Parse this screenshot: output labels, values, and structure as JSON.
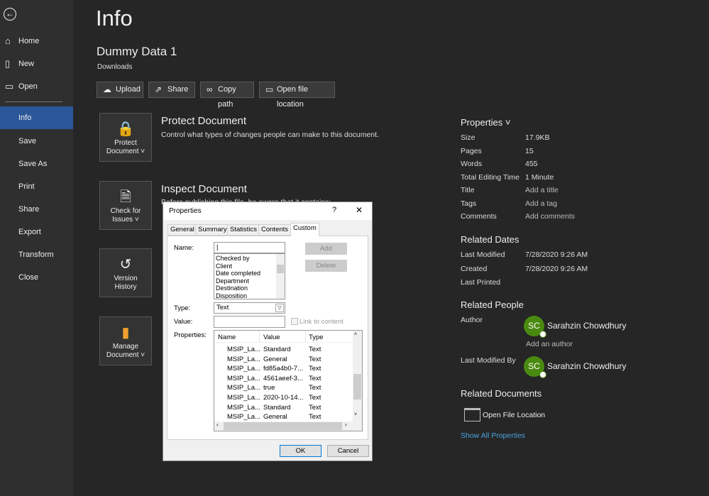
{
  "sidebar": {
    "back_icon": "back-arrow-icon",
    "items": [
      {
        "label": "Home",
        "icon": "home-icon"
      },
      {
        "label": "New",
        "icon": "new-document-icon"
      },
      {
        "label": "Open",
        "icon": "open-folder-icon"
      },
      {
        "label": "Info",
        "active": true
      },
      {
        "label": "Save"
      },
      {
        "label": "Save As"
      },
      {
        "label": "Print"
      },
      {
        "label": "Share"
      },
      {
        "label": "Export"
      },
      {
        "label": "Transform"
      },
      {
        "label": "Close"
      }
    ]
  },
  "page": {
    "title": "Info",
    "doc_name": "Dummy Data 1",
    "location": "Downloads"
  },
  "actions": [
    {
      "label": "Upload",
      "icon": "cloud-upload-icon"
    },
    {
      "label": "Share",
      "icon": "share-icon"
    },
    {
      "label": "Copy path",
      "icon": "link-icon"
    },
    {
      "label": "Open file location",
      "icon": "folder-icon"
    }
  ],
  "sections": [
    {
      "tile": [
        "Protect",
        "Document ˅"
      ],
      "title": "Protect Document",
      "desc": "Control what types of changes people can make to this document."
    },
    {
      "tile": [
        "Check for",
        "Issues ˅"
      ],
      "title": "Inspect Document",
      "desc": "Before publishing this file, be aware that it contains:"
    },
    {
      "tile": [
        "Version",
        "History"
      ]
    },
    {
      "tile": [
        "Manage",
        "Document ˅"
      ]
    }
  ],
  "properties": {
    "header": "Properties ˅",
    "rows": [
      {
        "label": "Size",
        "value": "17.9KB"
      },
      {
        "label": "Pages",
        "value": "15"
      },
      {
        "label": "Words",
        "value": "455"
      },
      {
        "label": "Total Editing Time",
        "value": "1 Minute"
      },
      {
        "label": "Title",
        "value": "Add a title"
      },
      {
        "label": "Tags",
        "value": "Add a tag"
      },
      {
        "label": "Comments",
        "value": "Add comments"
      }
    ]
  },
  "related_dates": {
    "header": "Related Dates",
    "rows": [
      {
        "label": "Last Modified",
        "value": "7/28/2020 9:26 AM"
      },
      {
        "label": "Created",
        "value": "7/28/2020 9:26 AM"
      },
      {
        "label": "Last Printed",
        "value": ""
      }
    ]
  },
  "related_people": {
    "header": "Related People",
    "author_label": "Author",
    "author": "Sarahzin Chowdhury",
    "initials": "SC",
    "add_author": "Add an author",
    "modified_label": "Last Modified By",
    "modified_by": "Sarahzin Chowdhury"
  },
  "related_docs": {
    "header": "Related Documents",
    "open_location": "Open File Location",
    "show_all": "Show All Properties"
  },
  "colors": {
    "accent": "#2b579a",
    "avatar": "#4a8a10",
    "link": "#4aa3df"
  },
  "dialog": {
    "title": "Properties",
    "help": "?",
    "close": "✕",
    "tabs": [
      "General",
      "Summary",
      "Statistics",
      "Contents",
      "Custom"
    ],
    "active_tab": "Custom",
    "name_label": "Name:",
    "name_value": "",
    "name_options": [
      "Checked by",
      "Client",
      "Date completed",
      "Department",
      "Destination",
      "Disposition"
    ],
    "add": "Add",
    "delete": "Delete",
    "type_label": "Type:",
    "type_value": "Text",
    "value_label": "Value:",
    "value_value": "",
    "link_to_content": "Link to content",
    "properties_label": "Properties:",
    "columns": [
      "Name",
      "Value",
      "Type"
    ],
    "rows": [
      [
        "MSIP_La...",
        "Standard",
        "Text"
      ],
      [
        "MSIP_La...",
        "General",
        "Text"
      ],
      [
        "MSIP_La...",
        "fd85a4b0-7...",
        "Text"
      ],
      [
        "MSIP_La...",
        "4561aeef-3...",
        "Text"
      ],
      [
        "MSIP_La...",
        "true",
        "Text"
      ],
      [
        "MSIP_La...",
        "2020-10-14...",
        "Text"
      ],
      [
        "MSIP_La...",
        "Standard",
        "Text"
      ],
      [
        "MSIP_La...",
        "General",
        "Text"
      ]
    ],
    "ok": "OK",
    "cancel": "Cancel"
  }
}
